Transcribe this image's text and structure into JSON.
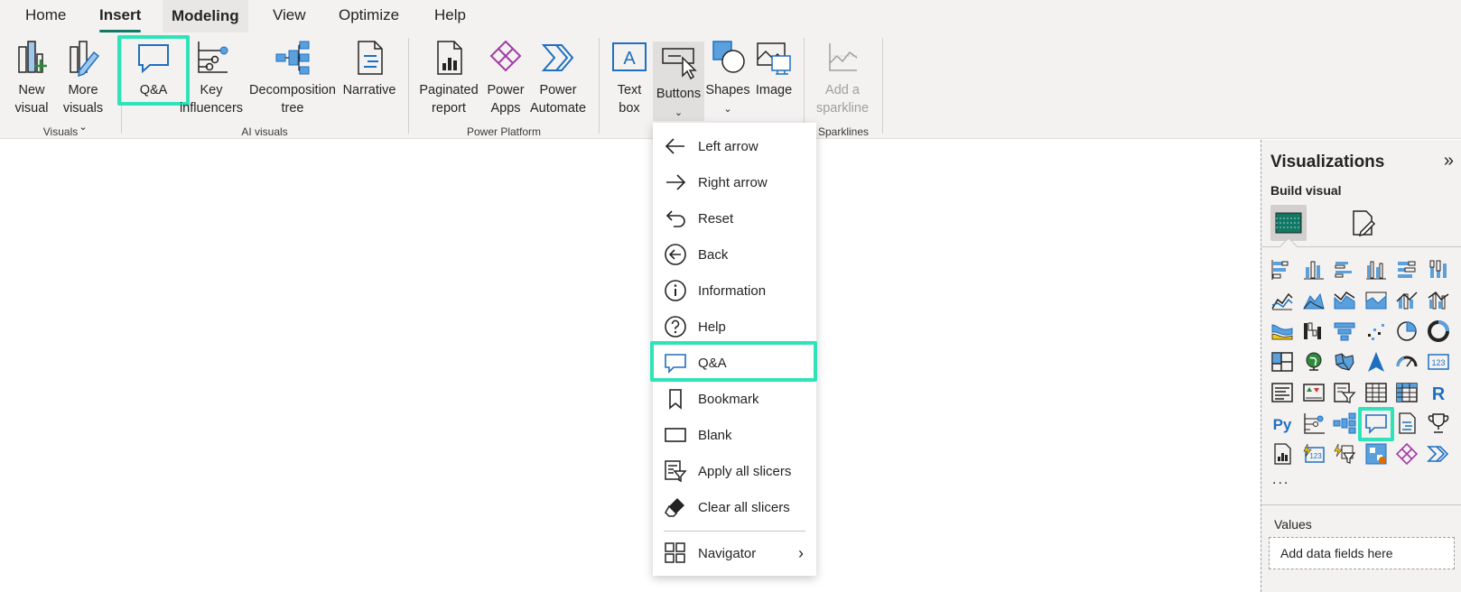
{
  "tabs": [
    "Home",
    "Insert",
    "Modeling",
    "View",
    "Optimize",
    "Help"
  ],
  "ribbon": {
    "new_visual": [
      "New",
      "visual"
    ],
    "more_visuals": [
      "More",
      "visuals"
    ],
    "qa": "Q&A",
    "key_influencers": [
      "Key",
      "influencers"
    ],
    "decomposition_tree": [
      "Decomposition",
      "tree"
    ],
    "narrative": "Narrative",
    "paginated_report": [
      "Paginated",
      "report"
    ],
    "power_apps": [
      "Power",
      "Apps"
    ],
    "power_automate": [
      "Power",
      "Automate"
    ],
    "text_box": [
      "Text",
      "box"
    ],
    "buttons": "Buttons",
    "shapes": "Shapes",
    "image": "Image",
    "add_sparkline": [
      "Add a",
      "sparkline"
    ],
    "groups": {
      "visuals": "Visuals",
      "ai_visuals": "AI visuals",
      "power_platform": "Power Platform",
      "sparklines": "Sparklines"
    }
  },
  "buttons_menu": [
    {
      "label": "Left arrow",
      "icon": "left-arrow-icon"
    },
    {
      "label": "Right arrow",
      "icon": "right-arrow-icon"
    },
    {
      "label": "Reset",
      "icon": "reset-icon"
    },
    {
      "label": "Back",
      "icon": "back-icon"
    },
    {
      "label": "Information",
      "icon": "information-icon"
    },
    {
      "label": "Help",
      "icon": "help-icon"
    },
    {
      "label": "Q&A",
      "icon": "qa-icon"
    },
    {
      "label": "Bookmark",
      "icon": "bookmark-icon"
    },
    {
      "label": "Blank",
      "icon": "blank-icon"
    },
    {
      "label": "Apply all slicers",
      "icon": "apply-slicers-icon"
    },
    {
      "label": "Clear all slicers",
      "icon": "eraser-icon"
    },
    {
      "label": "Navigator",
      "icon": "navigator-icon"
    }
  ],
  "viz_pane": {
    "title": "Visualizations",
    "build_visual": "Build visual",
    "more": "...",
    "values_label": "Values",
    "values_placeholder": "Add data fields here",
    "visual_icons": [
      "stacked-bar-icon",
      "stacked-column-icon",
      "clustered-bar-icon",
      "clustered-column-icon",
      "100-bar-icon",
      "100-column-icon",
      "line-chart-icon",
      "area-chart-icon",
      "stacked-area-icon",
      "100-area-icon",
      "line-column-icon",
      "line-clustered-icon",
      "ribbon-chart-icon",
      "waterfall-icon",
      "funnel-icon",
      "scatter-icon",
      "pie-icon",
      "donut-icon",
      "treemap-icon",
      "map-icon",
      "filled-map-icon",
      "azure-map-icon",
      "gauge-icon",
      "card-icon",
      "multi-row-card-icon",
      "kpi-icon",
      "slicer-icon",
      "table-icon",
      "matrix-icon",
      "r-visual-icon",
      "python-visual-icon",
      "key-influencers-icon",
      "decomposition-tree-icon",
      "qa-icon",
      "narrative-icon",
      "metrics-icon",
      "paginated-report-icon",
      "card-new-icon",
      "button-slicer-icon",
      "power-apps-icon",
      "power-apps-diamond-icon",
      "power-automate-icon"
    ]
  },
  "colors": {
    "accent": "#117865",
    "highlight": "#2fe3b8",
    "icon_blue": "#1f6fc0",
    "icon_fill": "#5aa0dc",
    "power_apps": "#a33ca5"
  }
}
